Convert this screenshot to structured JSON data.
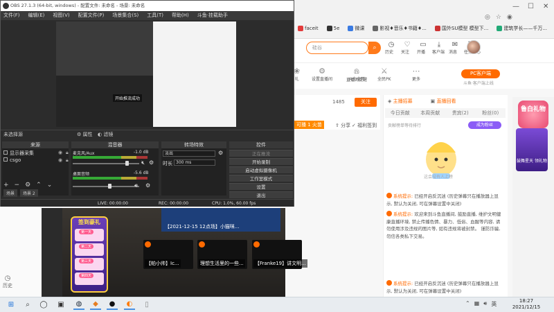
{
  "obs": {
    "title": "OBS 27.1.3 (64-bit, windows) - 配置文件: 未命名 - 场景: 未命名",
    "menu": [
      "文件(F)",
      "编辑(E)",
      "视图(V)",
      "配置文件(P)",
      "场景集合(S)",
      "工具(T)",
      "帮助(H)",
      "斗鱼·挂载助手"
    ],
    "preview_label": "开始推流成功",
    "scene_filter_label": "未选择源",
    "props_button": "属性",
    "filters_button": "滤镜",
    "docks": {
      "sources_header": "来源",
      "mixer_header": "混音器",
      "transitions_header": "转场特效",
      "controls_header": "控件"
    },
    "sources": [
      {
        "name": "显示器采集"
      },
      {
        "name": "csgo"
      }
    ],
    "mixer": [
      {
        "name": "麦克风/Aux",
        "db": "-1.0 dB"
      },
      {
        "name": "桌面音频",
        "db": "-5.6 dB"
      }
    ],
    "transition": {
      "type": "淡出",
      "duration_label": "时长",
      "duration_value": "300 ms"
    },
    "controls": [
      "正在推流",
      "开始录制",
      "启动虚拟摄像机",
      "工作室模式",
      "设置",
      "退出"
    ],
    "scenes_mini": [
      "场景",
      "场景 2"
    ],
    "status": {
      "live": "LIVE: 00:00:00",
      "rec": "REC: 00:00:00",
      "cpu": "CPU: 1.0%, 60.00 fps"
    }
  },
  "browser": {
    "bookmarks": [
      "faceit",
      "5e",
      "微课",
      "影视♦音乐♦书籍♦...",
      "国外SU模型 模型下...",
      "建筑学长——千万..."
    ],
    "search_placeholder": "硅谷",
    "header_icons": [
      {
        "icon": "history-icon",
        "label": "历史"
      },
      {
        "icon": "follow-icon",
        "label": "关注"
      },
      {
        "icon": "broadcast-icon",
        "label": "开播"
      },
      {
        "icon": "download-icon",
        "label": "客户端"
      },
      {
        "icon": "message-icon",
        "label": "消息"
      },
      {
        "icon": "task-icon",
        "label": "任务中心"
      }
    ],
    "nav": [
      {
        "label": "礼",
        "icon": "gift-icon"
      },
      {
        "label": "设置直播间",
        "icon": "setting-icon"
      },
      {
        "label": "直播间提醒",
        "icon": "bell-icon"
      },
      {
        "label": "火力全开",
        "icon": "fire-icon"
      },
      {
        "label": "全民PK",
        "icon": "pk-icon"
      },
      {
        "label": "更多",
        "icon": "more-icon"
      }
    ],
    "pc_client": "PC客户端",
    "pc_client_sub": "斗鱼·客户端上线"
  },
  "room": {
    "count": "1485",
    "follow": "关注",
    "hot": "可播 1 火苗",
    "share": "分享",
    "report": "福利签到"
  },
  "chat": {
    "top": [
      {
        "label": "主播招募"
      },
      {
        "label": "直播回看"
      }
    ],
    "tabs": [
      "今日贡献",
      "本周贡献",
      "贵宾(2)",
      "粉丝(0)"
    ],
    "rank_text": "贡献榜单等待排行",
    "rank_btn": "成为粉丝",
    "mascot_text": "这会没有人上榜",
    "messages": [
      {
        "k": "系统提示:",
        "text": "已经开启反沉迷 (历史弹幕只在播放器上显示, 默认为关闭, 可在弹幕设置中关闭)"
      },
      {
        "k": "系统提示:",
        "text": "欢迎来到斗鱼直播间, 鼓励直播, 维护文明健康直播环境, 禁止传播色情、暴力、低俗、血腥等内容, 请勿使用涉及违规的图片等, 如有违规将被封禁。 谨防诈骗, 勿信各类私下交易。"
      },
      {
        "k": "系统提示:",
        "text": "已经开启反沉迷 (历史弹幕只在播放器上显示, 默认为关闭, 可在弹幕设置中关闭)"
      }
    ]
  },
  "gift_side": {
    "top": "鲁白礼物",
    "card": "鼓舞星天 领礼物"
  },
  "video": {
    "promo_title": "签到豪礼",
    "promo_tags": [
      "第一天",
      "第二天",
      "第三天",
      "第四天"
    ],
    "banner": "【2021-12-15 12点场】小猫咪...",
    "thumbs": [
      {
        "label": "【帕小帅】Ic..."
      },
      {
        "label": "理想生活里的一些..."
      },
      {
        "label": "【Franke19】讲文明..."
      }
    ]
  },
  "history_label": "历史",
  "taskbar": {
    "apps": [
      "start-icon",
      "search-icon",
      "taskview-icon",
      "steam-icon",
      "edge-icon",
      "firefox-icon",
      "obs-icon",
      "file-icon"
    ],
    "time": "18:27",
    "date": "2021/12/15",
    "lang": "英"
  }
}
